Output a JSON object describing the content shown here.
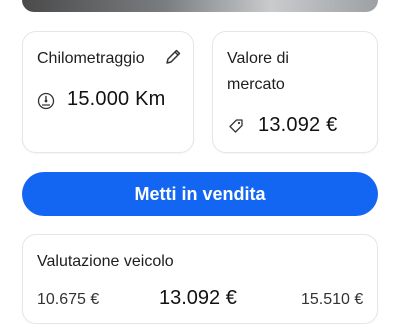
{
  "mileage_card": {
    "title": "Chilometraggio",
    "value": "15.000 Km",
    "edit_icon": "pencil-icon",
    "value_icon": "odometer-icon"
  },
  "value_card": {
    "title": "Valore di mercato",
    "value": "13.092 €",
    "value_icon": "tag-icon"
  },
  "sell_button": {
    "label": "Metti in vendita"
  },
  "valuation": {
    "title": "Valutazione veicolo",
    "low": "10.675 €",
    "mid": "13.092 €",
    "high": "15.510 €"
  },
  "colors": {
    "accent": "#1366f2",
    "card_border": "#e4e6ea"
  }
}
